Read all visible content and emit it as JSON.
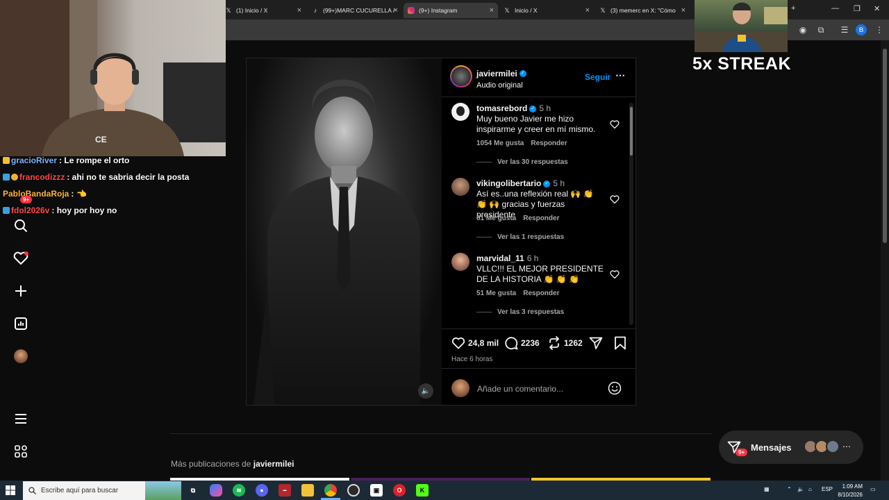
{
  "browser": {
    "tabs": [
      {
        "title": "(1) Inicio / X",
        "icon": "x-logo-icon",
        "active": false
      },
      {
        "title": "(99+)MARC CUCURELLA /",
        "icon": "tiktok-icon",
        "active": false
      },
      {
        "title": "(9+) Instagram",
        "icon": "instagram-icon",
        "active": true
      },
      {
        "title": "Inicio / X",
        "icon": "x-logo-icon",
        "active": false
      },
      {
        "title": "(3) memerc en X: \"Cómo",
        "icon": "x-logo-icon",
        "active": false
      }
    ],
    "profile_initial": "B"
  },
  "stream": {
    "streak_text": "5x STREAK",
    "chat": [
      {
        "user": "gracioRiver",
        "message": ": Le rompe el orto",
        "color": "#7fb2ff"
      },
      {
        "user": "francodizzz",
        "message": ": ahi no te sabria decir la posta",
        "color": "#ff4a4a"
      },
      {
        "user": "PabloBandaRoja",
        "message": ":",
        "color": "#ffb43a"
      },
      {
        "user": "fdol2026v",
        "message": ": hoy por hoy no",
        "color": "#ff4a4a"
      }
    ],
    "notification_badge": "9+"
  },
  "post": {
    "author": "javiermilei",
    "audio": "Audio original",
    "follow_label": "Seguir",
    "comments": [
      {
        "user": "tomasrebord",
        "time": "5 h",
        "text": "Muy bueno Javier me hizo inspirarme y creer en mí mismo.",
        "likes": "1054 Me gusta",
        "reply": "Responder",
        "replies": "Ver las 30 respuestas"
      },
      {
        "user": "vikingolibertario",
        "time": "5 h",
        "text": "Así es..una reflexión real 🙌 👏 👏 🙌 gracias y fuerzas presidente",
        "likes": "61 Me gusta",
        "reply": "Responder",
        "replies": "Ver las 1 respuestas"
      },
      {
        "user": "marvidal_11",
        "time": "6 h",
        "text": "VLLC!!! EL MEJOR PRESIDENTE DE LA HISTORIA 👏 👏 👏",
        "likes": "51 Me gusta",
        "reply": "Responder",
        "replies": "Ver las 3 respuestas"
      }
    ],
    "like_count": "24,8 mil",
    "comment_count": "2236",
    "repost_count": "1262",
    "posted_ago": "Hace 6 horas",
    "comment_placeholder": "Añade un comentario..."
  },
  "more_posts": {
    "prefix": "Más publicaciones de",
    "author": "javiermilei"
  },
  "messages": {
    "label": "Mensajes",
    "badge": "9+"
  },
  "taskbar": {
    "search_placeholder": "Escribe aquí para buscar",
    "lang": "ESP",
    "time": "1:09 AM",
    "date": "8/10/2026"
  },
  "colors": {
    "accent": "#0095f6",
    "background": "#0c0c0c",
    "badge": "#ff3040"
  }
}
